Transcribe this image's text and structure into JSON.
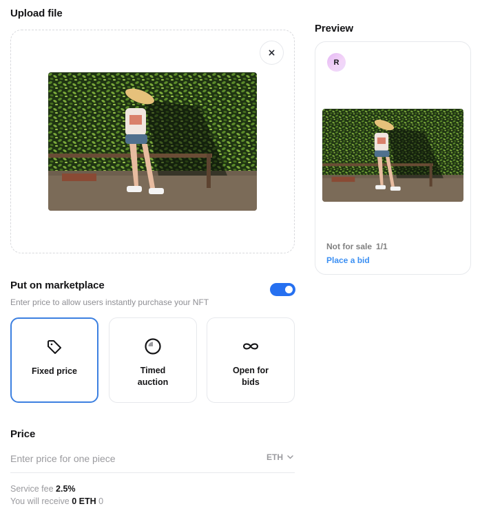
{
  "upload": {
    "title": "Upload file",
    "close_icon": "close-icon",
    "photo_alt": "Girl with blonde hair sitting on a rusty bench in front of a green hedge"
  },
  "preview": {
    "title": "Preview",
    "avatar_letter": "R",
    "status": "Not for sale",
    "edition": "1/1",
    "action": "Place a bid"
  },
  "marketplace": {
    "title": "Put on marketplace",
    "description": "Enter price to allow users instantly purchase your NFT",
    "enabled": true,
    "accent_color": "#2670f0",
    "options": [
      {
        "label": "Fixed price",
        "icon": "price-tag-icon",
        "selected": true
      },
      {
        "label": "Timed auction",
        "icon": "timer-icon",
        "selected": false
      },
      {
        "label": "Open for bids",
        "icon": "infinity-icon",
        "selected": false
      }
    ]
  },
  "price": {
    "title": "Price",
    "placeholder": "Enter price for one piece",
    "value": "",
    "currency": "ETH",
    "service_fee_label": "Service fee",
    "service_fee_value": "2.5%",
    "receive_label": "You will receive",
    "receive_value": "0 ETH",
    "receive_fiat": "0"
  }
}
